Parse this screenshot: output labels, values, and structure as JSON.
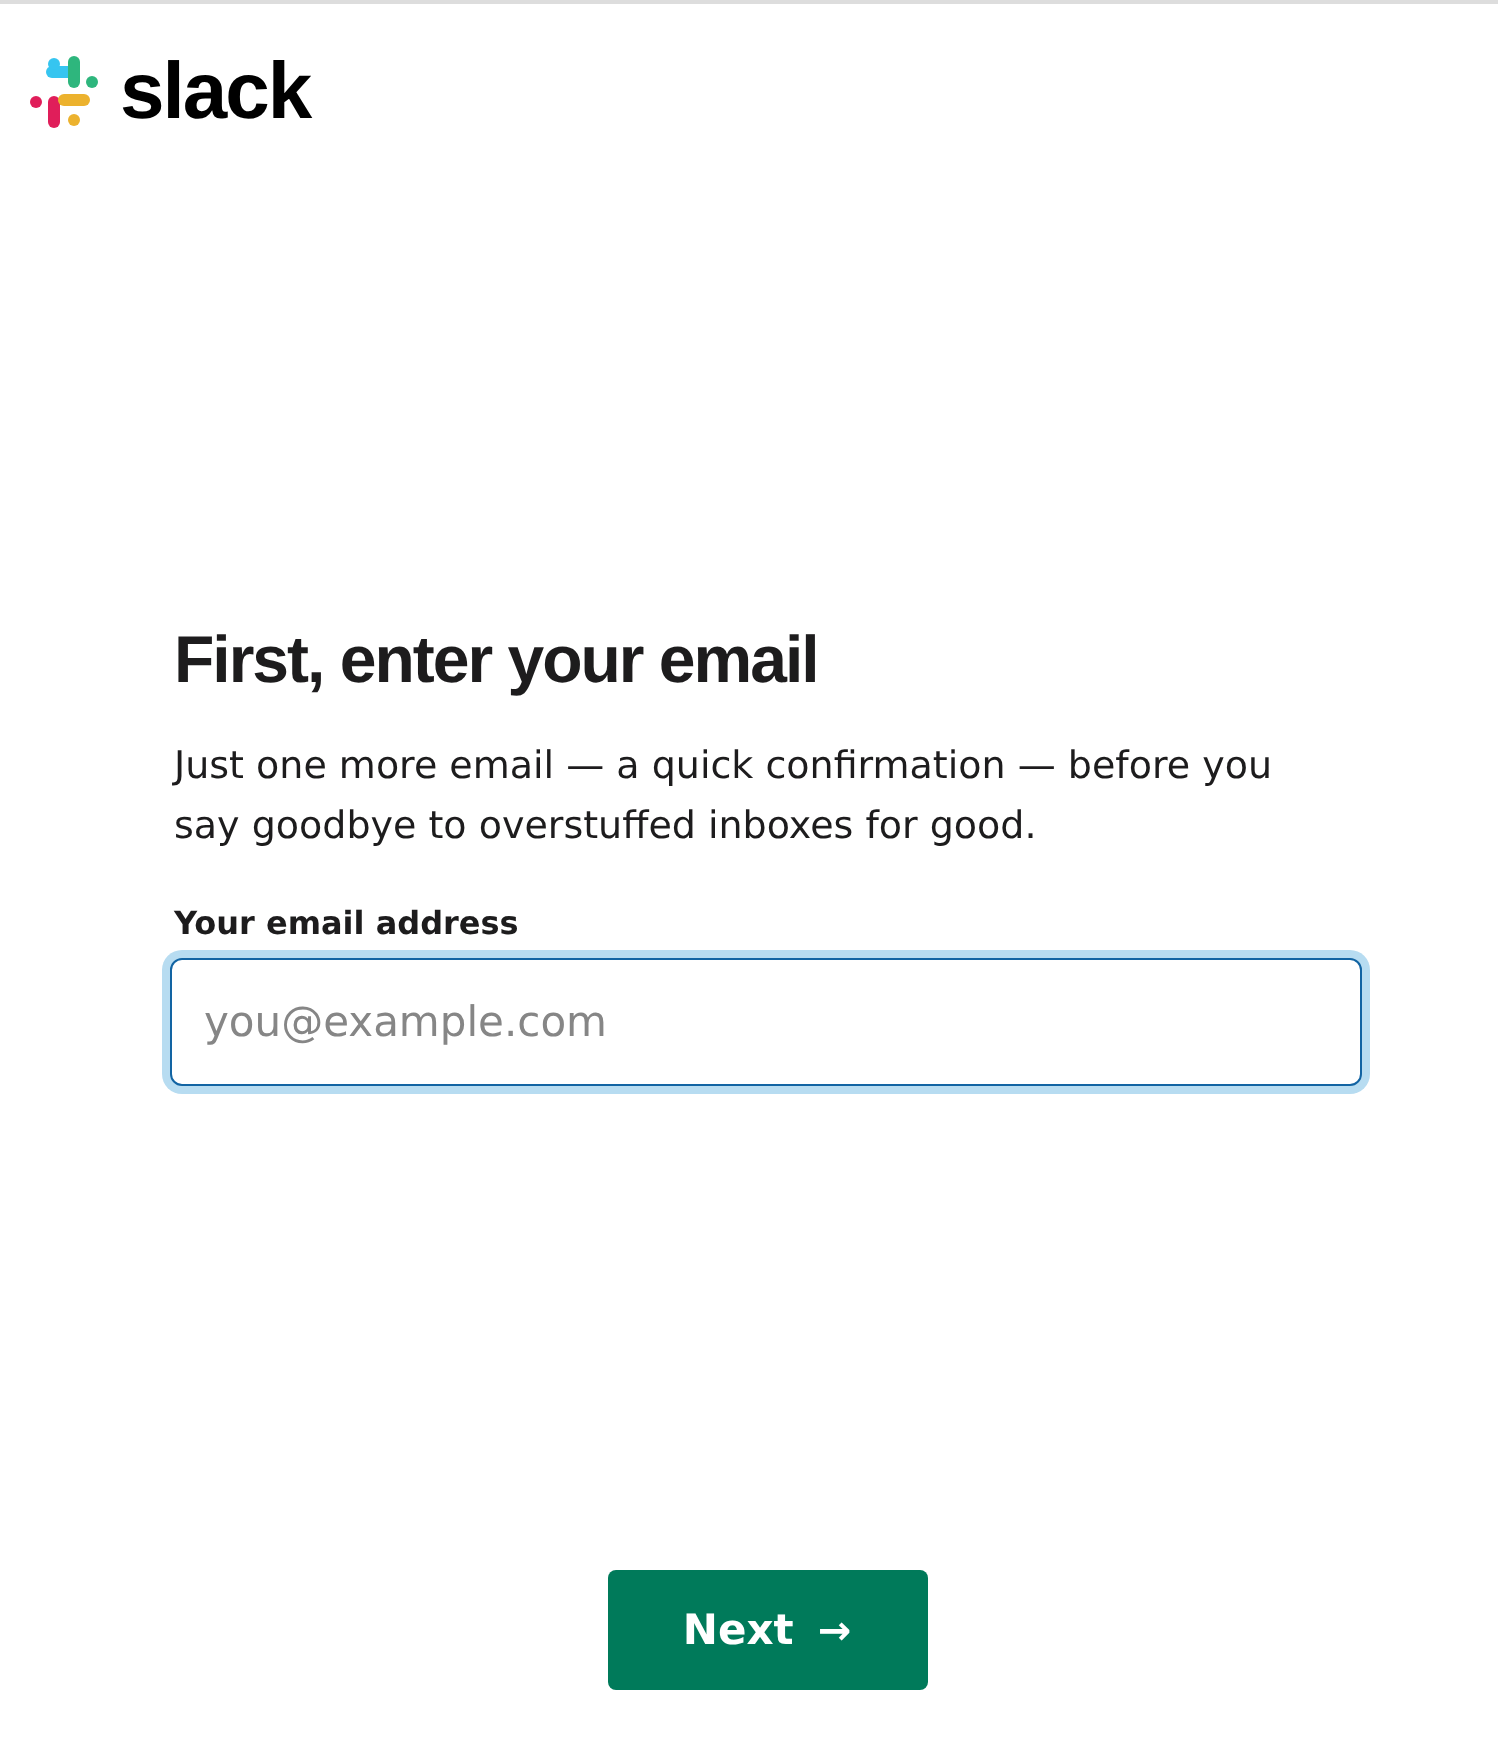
{
  "logo": {
    "wordmark": "slack"
  },
  "heading": "First, enter your email",
  "description": "Just one more email — a quick confirmation — before you say goodbye to overstuffed inboxes for good.",
  "email_field": {
    "label": "Your email address",
    "placeholder": "you@example.com",
    "focused": true
  },
  "next_button": {
    "label": "Next",
    "icon": "→"
  }
}
